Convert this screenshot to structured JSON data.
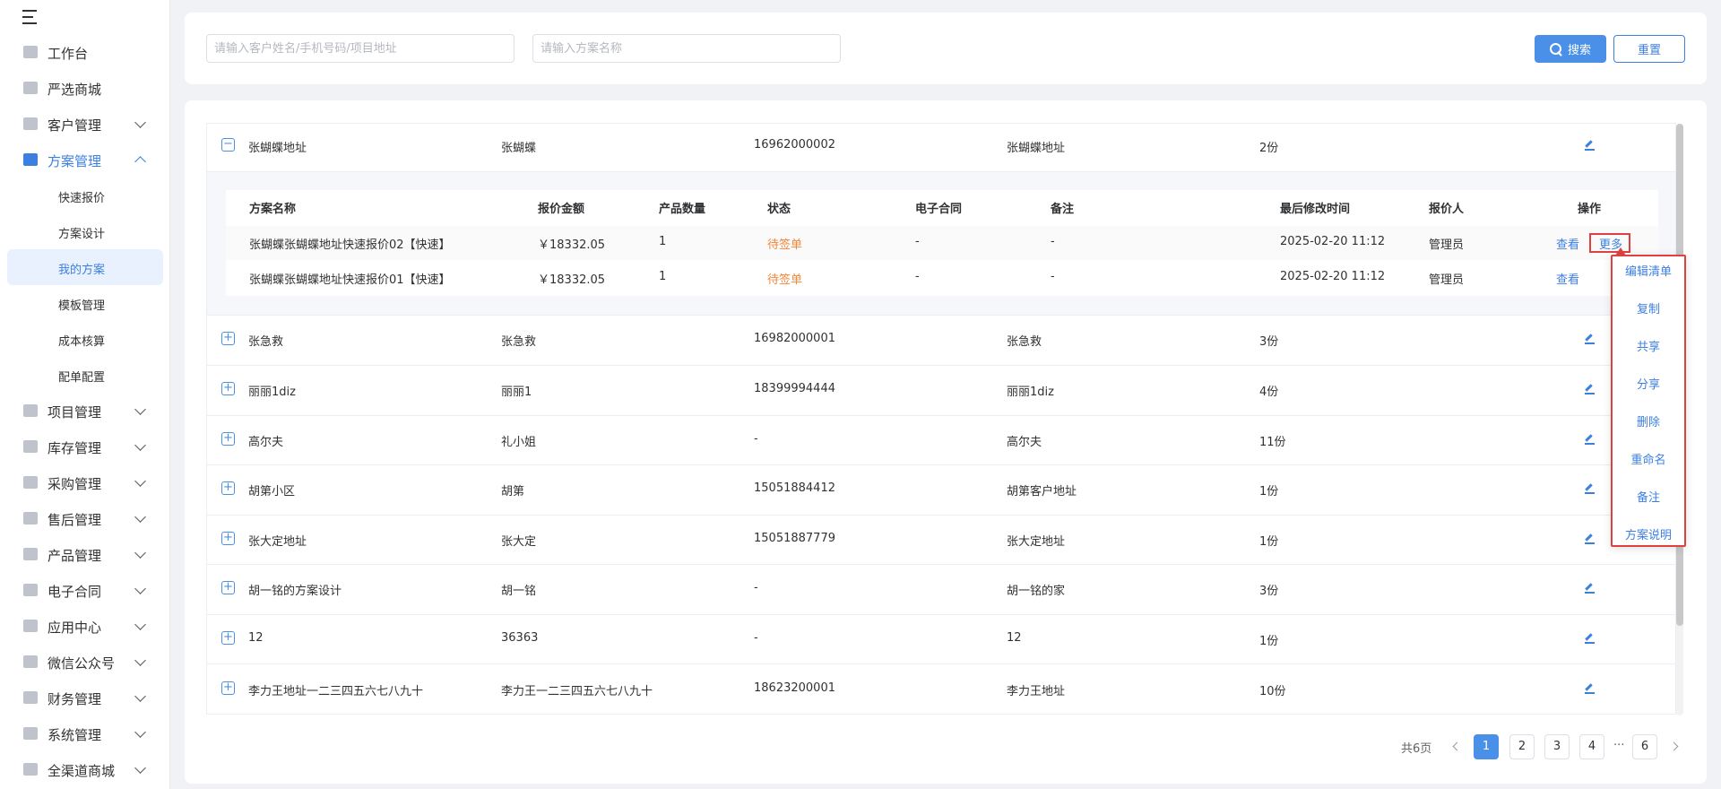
{
  "sidebar": {
    "items": [
      {
        "label": "工作台"
      },
      {
        "label": "严选商城"
      },
      {
        "label": "客户管理"
      },
      {
        "label": "方案管理"
      },
      {
        "label": "项目管理"
      },
      {
        "label": "库存管理"
      },
      {
        "label": "采购管理"
      },
      {
        "label": "售后管理"
      },
      {
        "label": "产品管理"
      },
      {
        "label": "电子合同"
      },
      {
        "label": "应用中心"
      },
      {
        "label": "微信公众号"
      },
      {
        "label": "财务管理"
      },
      {
        "label": "系统管理"
      },
      {
        "label": "全渠道商城"
      }
    ],
    "sub_items": [
      {
        "label": "快速报价"
      },
      {
        "label": "方案设计"
      },
      {
        "label": "我的方案"
      },
      {
        "label": "模板管理"
      },
      {
        "label": "成本核算"
      },
      {
        "label": "配单配置"
      }
    ]
  },
  "search": {
    "customer_placeholder": "请输入客户姓名/手机号码/项目地址",
    "plan_placeholder": "请输入方案名称",
    "search_label": "搜索",
    "reset_label": "重置"
  },
  "table": {
    "rows": [
      {
        "project": "张蝴蝶地址",
        "customer": "张蝴蝶",
        "phone": "16962000002",
        "address": "张蝴蝶地址",
        "count": "2份",
        "expanded": true
      },
      {
        "project": "张急救",
        "customer": "张急救",
        "phone": "16982000001",
        "address": "张急救",
        "count": "3份"
      },
      {
        "project": "丽丽1diz",
        "customer": "丽丽1",
        "phone": "18399994444",
        "address": "丽丽1diz",
        "count": "4份"
      },
      {
        "project": "高尔夫",
        "customer": "礼小姐",
        "phone": "-",
        "address": "高尔夫",
        "count": "11份"
      },
      {
        "project": "胡第小区",
        "customer": "胡第",
        "phone": "15051884412",
        "address": "胡第客户地址",
        "count": "1份"
      },
      {
        "project": "张大定地址",
        "customer": "张大定",
        "phone": "15051887779",
        "address": "张大定地址",
        "count": "1份"
      },
      {
        "project": "胡一铭的方案设计",
        "customer": "胡一铭",
        "phone": "-",
        "address": "胡一铭的家",
        "count": "3份"
      },
      {
        "project": "12",
        "customer": "36363",
        "phone": "-",
        "address": "12",
        "count": "1份"
      },
      {
        "project": "李力王地址一二三四五六七八九十",
        "customer": "李力王一二三四五六七八九十",
        "phone": "18623200001",
        "address": "李力王地址",
        "count": "10份"
      }
    ],
    "expand_symbol": "+",
    "collapse_symbol": "−"
  },
  "sub_table": {
    "headers": {
      "name": "方案名称",
      "amount": "报价金额",
      "qty": "产品数量",
      "status": "状态",
      "contract": "电子合同",
      "note": "备注",
      "modified": "最后修改时间",
      "quoter": "报价人",
      "action": "操作"
    },
    "rows": [
      {
        "name": "张蝴蝶张蝴蝶地址快速报价02【快速】",
        "amount": "￥18332.05",
        "qty": "1",
        "status": "待签单",
        "contract": "-",
        "note": "-",
        "modified": "2025-02-20 11:12",
        "quoter": "管理员",
        "view": "查看",
        "more": "更多"
      },
      {
        "name": "张蝴蝶张蝴蝶地址快速报价01【快速】",
        "amount": "￥18332.05",
        "qty": "1",
        "status": "待签单",
        "contract": "-",
        "note": "-",
        "modified": "2025-02-20 11:12",
        "quoter": "管理员",
        "view": "查看"
      }
    ]
  },
  "more_menu": {
    "items": [
      "编辑清单",
      "复制",
      "共享",
      "分享",
      "删除",
      "重命名",
      "备注",
      "方案说明"
    ]
  },
  "pagination": {
    "total": "共6页",
    "pages": [
      "1",
      "2",
      "3",
      "4",
      "6"
    ],
    "current": "1",
    "ellipsis": "···"
  },
  "colors": {
    "primary": "#4a90e8",
    "link": "#3d7fe0",
    "pending": "#f0883c",
    "highlight": "#e04040"
  }
}
